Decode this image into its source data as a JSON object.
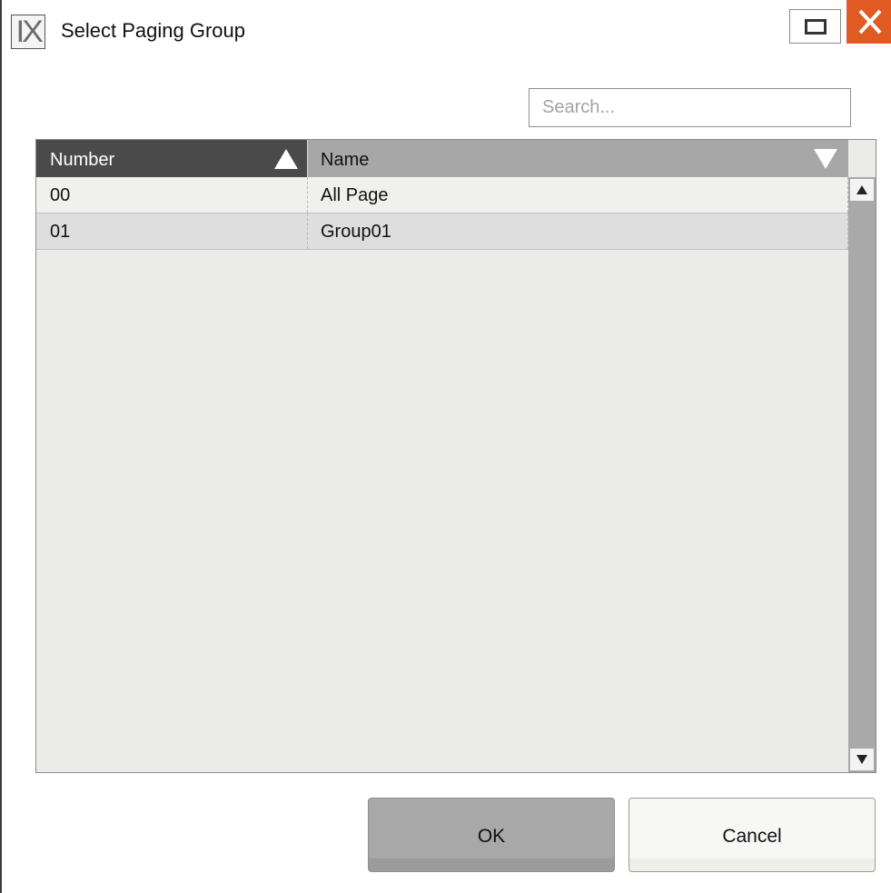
{
  "window": {
    "title": "Select Paging Group",
    "logo_text": "IX",
    "maximize_label": "",
    "close_label": ""
  },
  "search": {
    "placeholder": "Search...",
    "value": ""
  },
  "table": {
    "columns": [
      {
        "label": "Number",
        "sort": "ascending"
      },
      {
        "label": "Name",
        "sort": "descending"
      }
    ],
    "rows": [
      {
        "number": "00",
        "name": "All Page"
      },
      {
        "number": "01",
        "name": "Group01"
      }
    ]
  },
  "buttons": {
    "ok_label": "OK",
    "cancel_label": "Cancel"
  },
  "colors": {
    "close_button": "#e05a24",
    "header_number_bg": "#4a4a4a",
    "header_name_bg": "#a7a7a7",
    "grid_bg": "#ebebea",
    "ok_button_bg": "#a8a8a8"
  },
  "icons": {
    "logo": "ix-logo-icon",
    "maximize": "maximize-icon",
    "close": "close-icon",
    "sort_up": "sort-ascending-icon",
    "sort_down": "sort-descending-icon",
    "scroll_up": "scroll-up-arrow-icon",
    "scroll_down": "scroll-down-arrow-icon"
  }
}
